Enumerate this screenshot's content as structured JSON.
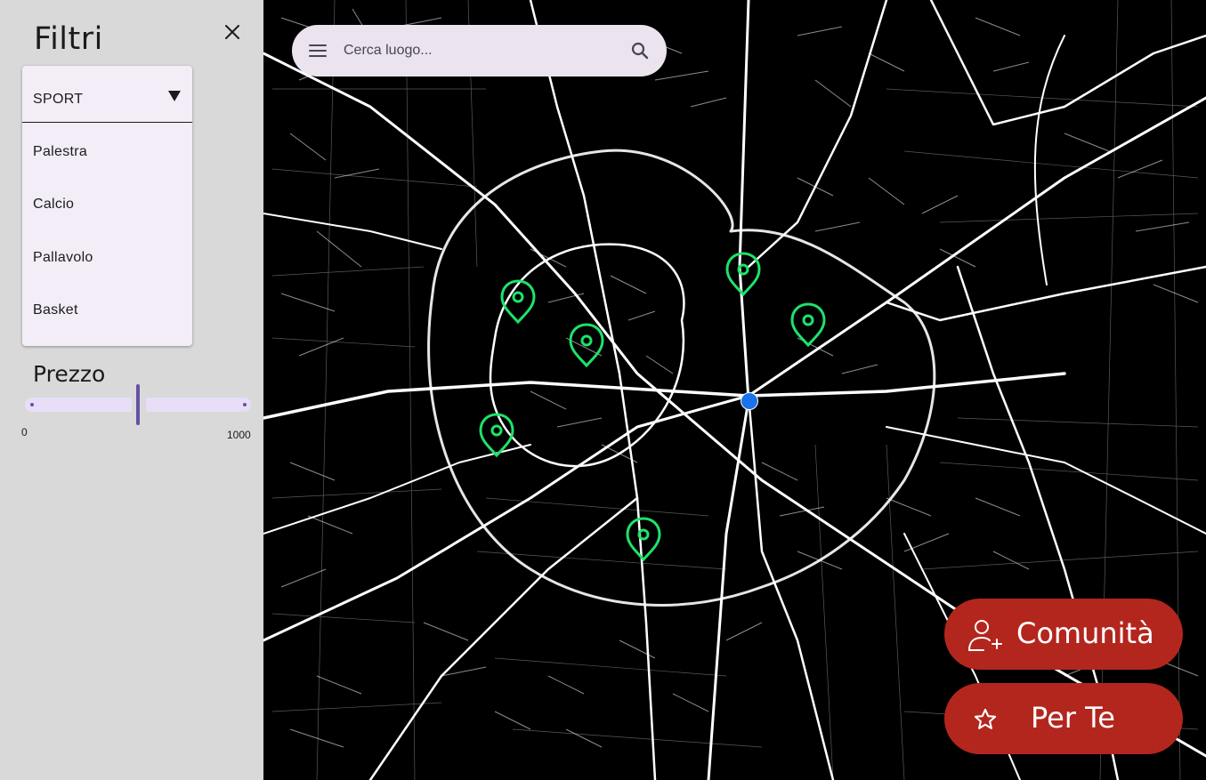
{
  "sidebar": {
    "title": "Filtri",
    "close_icon": "close-icon",
    "category": {
      "selected": "SPORT",
      "options": [
        "Palestra",
        "Calcio",
        "Pallavolo",
        "Basket"
      ]
    },
    "price": {
      "label": "Prezzo",
      "min": "0",
      "max": "1000",
      "value_fraction": 0.5
    }
  },
  "search": {
    "placeholder": "Cerca luogo...",
    "menu_icon": "menu-icon",
    "search_icon": "search-icon"
  },
  "map": {
    "pins_count": 6,
    "pin_color": "#1ee36a",
    "user_location_color": "#1a73e8"
  },
  "fabs": {
    "community": {
      "label": "Comunità",
      "icon": "add-person-icon"
    },
    "for_you": {
      "label": "Per Te",
      "icon": "star-icon"
    },
    "color": "#b3261e"
  }
}
